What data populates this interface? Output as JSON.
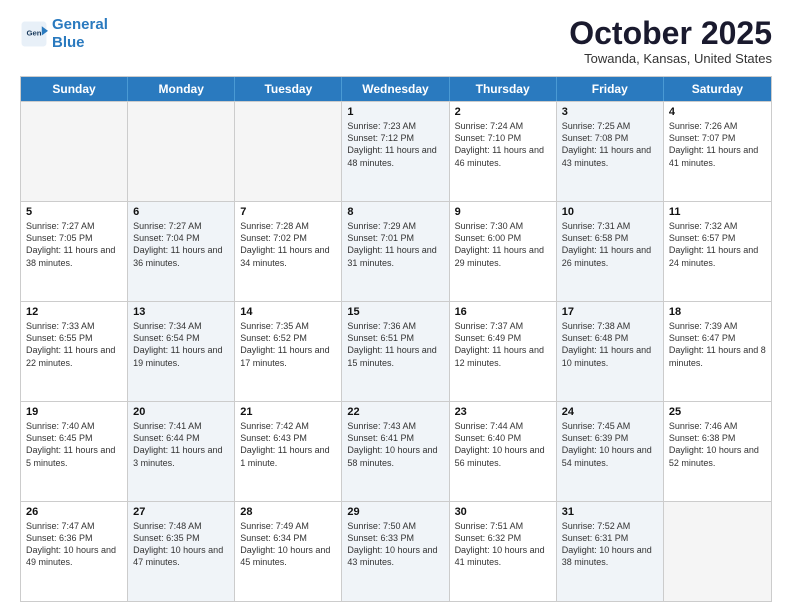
{
  "header": {
    "logo_line1": "General",
    "logo_line2": "Blue",
    "month_title": "October 2025",
    "location": "Towanda, Kansas, United States"
  },
  "days_of_week": [
    "Sunday",
    "Monday",
    "Tuesday",
    "Wednesday",
    "Thursday",
    "Friday",
    "Saturday"
  ],
  "rows": [
    [
      {
        "day": "",
        "sunrise": "",
        "sunset": "",
        "daylight": "",
        "shade": false,
        "empty": true
      },
      {
        "day": "",
        "sunrise": "",
        "sunset": "",
        "daylight": "",
        "shade": true,
        "empty": true
      },
      {
        "day": "",
        "sunrise": "",
        "sunset": "",
        "daylight": "",
        "shade": false,
        "empty": true
      },
      {
        "day": "1",
        "sunrise": "Sunrise: 7:23 AM",
        "sunset": "Sunset: 7:12 PM",
        "daylight": "Daylight: 11 hours and 48 minutes.",
        "shade": true
      },
      {
        "day": "2",
        "sunrise": "Sunrise: 7:24 AM",
        "sunset": "Sunset: 7:10 PM",
        "daylight": "Daylight: 11 hours and 46 minutes.",
        "shade": false
      },
      {
        "day": "3",
        "sunrise": "Sunrise: 7:25 AM",
        "sunset": "Sunset: 7:08 PM",
        "daylight": "Daylight: 11 hours and 43 minutes.",
        "shade": true
      },
      {
        "day": "4",
        "sunrise": "Sunrise: 7:26 AM",
        "sunset": "Sunset: 7:07 PM",
        "daylight": "Daylight: 11 hours and 41 minutes.",
        "shade": false
      }
    ],
    [
      {
        "day": "5",
        "sunrise": "Sunrise: 7:27 AM",
        "sunset": "Sunset: 7:05 PM",
        "daylight": "Daylight: 11 hours and 38 minutes.",
        "shade": false
      },
      {
        "day": "6",
        "sunrise": "Sunrise: 7:27 AM",
        "sunset": "Sunset: 7:04 PM",
        "daylight": "Daylight: 11 hours and 36 minutes.",
        "shade": true
      },
      {
        "day": "7",
        "sunrise": "Sunrise: 7:28 AM",
        "sunset": "Sunset: 7:02 PM",
        "daylight": "Daylight: 11 hours and 34 minutes.",
        "shade": false
      },
      {
        "day": "8",
        "sunrise": "Sunrise: 7:29 AM",
        "sunset": "Sunset: 7:01 PM",
        "daylight": "Daylight: 11 hours and 31 minutes.",
        "shade": true
      },
      {
        "day": "9",
        "sunrise": "Sunrise: 7:30 AM",
        "sunset": "Sunset: 6:00 PM",
        "daylight": "Daylight: 11 hours and 29 minutes.",
        "shade": false
      },
      {
        "day": "10",
        "sunrise": "Sunrise: 7:31 AM",
        "sunset": "Sunset: 6:58 PM",
        "daylight": "Daylight: 11 hours and 26 minutes.",
        "shade": true
      },
      {
        "day": "11",
        "sunrise": "Sunrise: 7:32 AM",
        "sunset": "Sunset: 6:57 PM",
        "daylight": "Daylight: 11 hours and 24 minutes.",
        "shade": false
      }
    ],
    [
      {
        "day": "12",
        "sunrise": "Sunrise: 7:33 AM",
        "sunset": "Sunset: 6:55 PM",
        "daylight": "Daylight: 11 hours and 22 minutes.",
        "shade": false
      },
      {
        "day": "13",
        "sunrise": "Sunrise: 7:34 AM",
        "sunset": "Sunset: 6:54 PM",
        "daylight": "Daylight: 11 hours and 19 minutes.",
        "shade": true
      },
      {
        "day": "14",
        "sunrise": "Sunrise: 7:35 AM",
        "sunset": "Sunset: 6:52 PM",
        "daylight": "Daylight: 11 hours and 17 minutes.",
        "shade": false
      },
      {
        "day": "15",
        "sunrise": "Sunrise: 7:36 AM",
        "sunset": "Sunset: 6:51 PM",
        "daylight": "Daylight: 11 hours and 15 minutes.",
        "shade": true
      },
      {
        "day": "16",
        "sunrise": "Sunrise: 7:37 AM",
        "sunset": "Sunset: 6:49 PM",
        "daylight": "Daylight: 11 hours and 12 minutes.",
        "shade": false
      },
      {
        "day": "17",
        "sunrise": "Sunrise: 7:38 AM",
        "sunset": "Sunset: 6:48 PM",
        "daylight": "Daylight: 11 hours and 10 minutes.",
        "shade": true
      },
      {
        "day": "18",
        "sunrise": "Sunrise: 7:39 AM",
        "sunset": "Sunset: 6:47 PM",
        "daylight": "Daylight: 11 hours and 8 minutes.",
        "shade": false
      }
    ],
    [
      {
        "day": "19",
        "sunrise": "Sunrise: 7:40 AM",
        "sunset": "Sunset: 6:45 PM",
        "daylight": "Daylight: 11 hours and 5 minutes.",
        "shade": false
      },
      {
        "day": "20",
        "sunrise": "Sunrise: 7:41 AM",
        "sunset": "Sunset: 6:44 PM",
        "daylight": "Daylight: 11 hours and 3 minutes.",
        "shade": true
      },
      {
        "day": "21",
        "sunrise": "Sunrise: 7:42 AM",
        "sunset": "Sunset: 6:43 PM",
        "daylight": "Daylight: 11 hours and 1 minute.",
        "shade": false
      },
      {
        "day": "22",
        "sunrise": "Sunrise: 7:43 AM",
        "sunset": "Sunset: 6:41 PM",
        "daylight": "Daylight: 10 hours and 58 minutes.",
        "shade": true
      },
      {
        "day": "23",
        "sunrise": "Sunrise: 7:44 AM",
        "sunset": "Sunset: 6:40 PM",
        "daylight": "Daylight: 10 hours and 56 minutes.",
        "shade": false
      },
      {
        "day": "24",
        "sunrise": "Sunrise: 7:45 AM",
        "sunset": "Sunset: 6:39 PM",
        "daylight": "Daylight: 10 hours and 54 minutes.",
        "shade": true
      },
      {
        "day": "25",
        "sunrise": "Sunrise: 7:46 AM",
        "sunset": "Sunset: 6:38 PM",
        "daylight": "Daylight: 10 hours and 52 minutes.",
        "shade": false
      }
    ],
    [
      {
        "day": "26",
        "sunrise": "Sunrise: 7:47 AM",
        "sunset": "Sunset: 6:36 PM",
        "daylight": "Daylight: 10 hours and 49 minutes.",
        "shade": false
      },
      {
        "day": "27",
        "sunrise": "Sunrise: 7:48 AM",
        "sunset": "Sunset: 6:35 PM",
        "daylight": "Daylight: 10 hours and 47 minutes.",
        "shade": true
      },
      {
        "day": "28",
        "sunrise": "Sunrise: 7:49 AM",
        "sunset": "Sunset: 6:34 PM",
        "daylight": "Daylight: 10 hours and 45 minutes.",
        "shade": false
      },
      {
        "day": "29",
        "sunrise": "Sunrise: 7:50 AM",
        "sunset": "Sunset: 6:33 PM",
        "daylight": "Daylight: 10 hours and 43 minutes.",
        "shade": true
      },
      {
        "day": "30",
        "sunrise": "Sunrise: 7:51 AM",
        "sunset": "Sunset: 6:32 PM",
        "daylight": "Daylight: 10 hours and 41 minutes.",
        "shade": false
      },
      {
        "day": "31",
        "sunrise": "Sunrise: 7:52 AM",
        "sunset": "Sunset: 6:31 PM",
        "daylight": "Daylight: 10 hours and 38 minutes.",
        "shade": true
      },
      {
        "day": "",
        "sunrise": "",
        "sunset": "",
        "daylight": "",
        "shade": false,
        "empty": true
      }
    ]
  ]
}
